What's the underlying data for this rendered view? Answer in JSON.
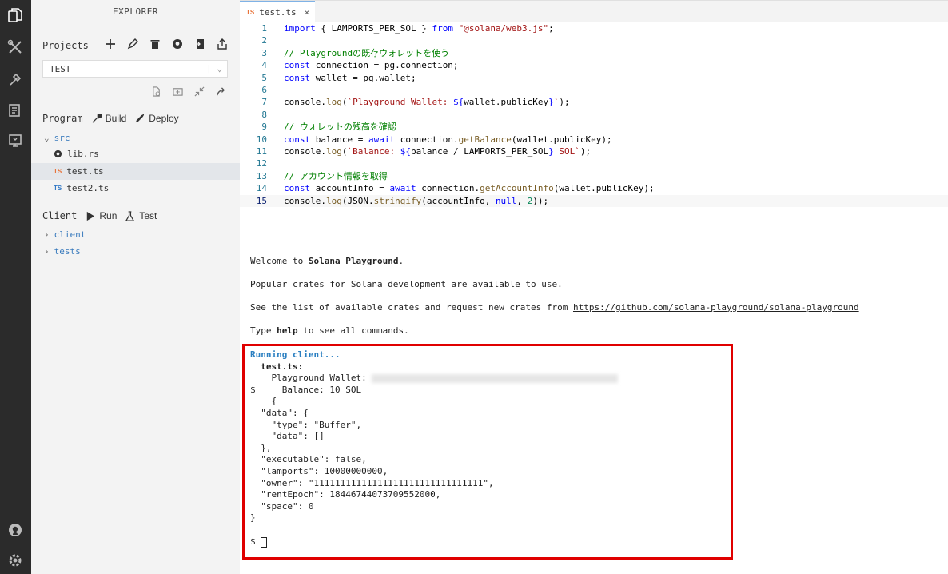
{
  "sidebar": {
    "title": "EXPLORER",
    "projects_label": "Projects",
    "project_select": "TEST",
    "program_label": "Program",
    "build_label": "Build",
    "deploy_label": "Deploy",
    "src_folder": "src",
    "files": [
      {
        "name": "lib.rs",
        "type": "rust"
      },
      {
        "name": "test.ts",
        "type": "ts",
        "selected": true
      },
      {
        "name": "test2.ts",
        "type": "ts"
      }
    ],
    "client_label": "Client",
    "run_label": "Run",
    "test_label": "Test",
    "client_folders": [
      "client",
      "tests"
    ],
    "ts_badge": "TS"
  },
  "tab": {
    "badge": "TS",
    "name": "test.ts",
    "close": "×"
  },
  "code_lines": [
    "import { LAMPORTS_PER_SOL } from \"@solana/web3.js\";",
    "",
    "// Playgroundの既存ウォレットを使う",
    "const connection = pg.connection;",
    "const wallet = pg.wallet;",
    "",
    "console.log(`Playground Wallet: ${wallet.publicKey}`);",
    "",
    "// ウォレットの残高を確認",
    "const balance = await connection.getBalance(wallet.publicKey);",
    "console.log(`Balance: ${balance / LAMPORTS_PER_SOL} SOL`);",
    "",
    "// アカウント情報を取得",
    "const accountInfo = await connection.getAccountInfo(wallet.publicKey);",
    "console.log(JSON.stringify(accountInfo, null, 2));"
  ],
  "terminal": {
    "welcome_prefix": "Welcome to ",
    "welcome_bold": "Solana Playground",
    "welcome_suffix": ".",
    "popular": "Popular crates for Solana development are available to use.",
    "see_list_prefix": "See the list of available crates and request new crates from ",
    "see_list_link": "https://github.com/solana-playground/solana-playground",
    "type_prefix": "Type ",
    "type_bold": "help",
    "type_suffix": " to see all commands.",
    "running": "Running client...",
    "test_file": "  test.ts:",
    "wallet_line": "    Playground Wallet: ",
    "balance_line": "$     Balance: 10 SOL",
    "output": [
      "    {",
      "  \"data\": {",
      "    \"type\": \"Buffer\",",
      "    \"data\": []",
      "  },",
      "  \"executable\": false,",
      "  \"lamports\": 10000000000,",
      "  \"owner\": \"11111111111111111111111111111111\",",
      "  \"rentEpoch\": 18446744073709552000,",
      "  \"space\": 0",
      "}"
    ],
    "prompt": "$ "
  }
}
